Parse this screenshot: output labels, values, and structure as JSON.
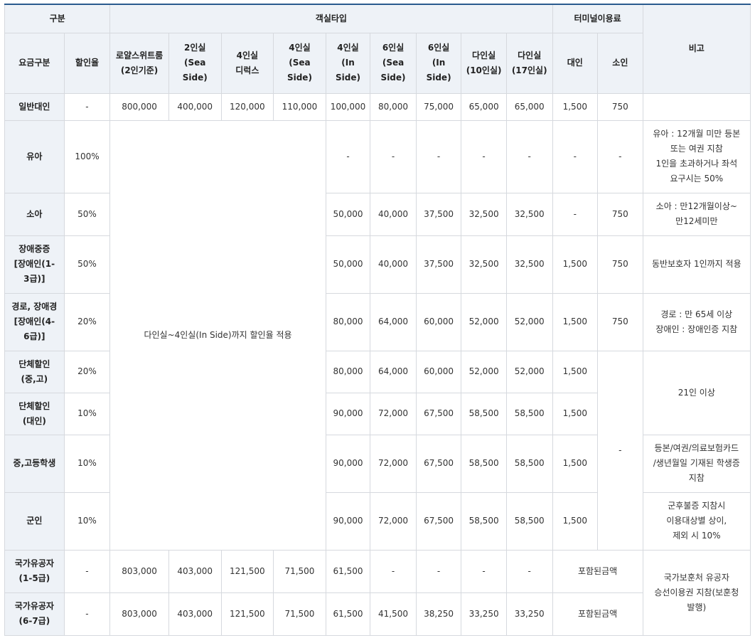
{
  "header": {
    "gubun": "구분",
    "room_type": "객실타입",
    "terminal_fee": "터미널이용료",
    "remarks": "비고",
    "fare_class": "요금구분",
    "discount_rate": "할인율",
    "rooms": [
      "로얄스위트룸\n(2인기준)",
      "2인실\n(Sea\nSide)",
      "4인실\n디럭스",
      "4인실\n(Sea\nSide)",
      "4인실\n(In Side)",
      "6인실\n(Sea\nSide)",
      "6인실\n(In\nSide)",
      "다인실\n(10인실)",
      "다인실\n(17인실)"
    ],
    "adult": "대인",
    "child": "소인"
  },
  "rows": {
    "general": {
      "label": "일반대인",
      "rate": "-",
      "prices": [
        "800,000",
        "400,000",
        "120,000",
        "110,000",
        "100,000",
        "80,000",
        "75,000",
        "65,000",
        "65,000"
      ],
      "adult_fee": "1,500",
      "child_fee": "750",
      "note": ""
    },
    "infant": {
      "label": "유아",
      "rate": "100%",
      "prices": [
        "-",
        "-",
        "-",
        "-",
        "-"
      ],
      "adult_fee": "-",
      "child_fee": "-",
      "note": "유아 : 12개월 미만 등본\n또는 여권 지참\n1인을 초과하거나 좌석\n요구시는 50%"
    },
    "child": {
      "label": "소아",
      "rate": "50%",
      "prices": [
        "50,000",
        "40,000",
        "37,500",
        "32,500",
        "32,500"
      ],
      "adult_fee": "-",
      "child_fee": "750",
      "note": "소아 : 만12개월이상~\n만12세미만"
    },
    "disabled_severe": {
      "label": "장애중증\n[장애인(1-\n3급)]",
      "rate": "50%",
      "prices": [
        "50,000",
        "40,000",
        "37,500",
        "32,500",
        "32,500"
      ],
      "adult_fee": "1,500",
      "child_fee": "750",
      "note": "동반보호자 1인까지 적용"
    },
    "senior": {
      "label": "경로, 장애경\n[장애인(4-\n6급)]",
      "rate": "20%",
      "prices": [
        "80,000",
        "64,000",
        "60,000",
        "52,000",
        "52,000"
      ],
      "adult_fee": "1,500",
      "child_fee": "750",
      "note": "경로 : 만 65세 이상\n장애인 : 장애인증 지참"
    },
    "group_student": {
      "label": "단체할인\n(중,고)",
      "rate": "20%",
      "prices": [
        "80,000",
        "64,000",
        "60,000",
        "52,000",
        "52,000"
      ],
      "adult_fee": "1,500"
    },
    "group_adult": {
      "label": "단체할인\n(대인)",
      "rate": "10%",
      "prices": [
        "90,000",
        "72,000",
        "67,500",
        "58,500",
        "58,500"
      ],
      "adult_fee": "1,500"
    },
    "student": {
      "label": "중,고등학생",
      "rate": "10%",
      "prices": [
        "90,000",
        "72,000",
        "67,500",
        "58,500",
        "58,500"
      ],
      "adult_fee": "1,500",
      "note": "등본/여권/의료보험카드\n/생년월일 기재된 학생증\n지참"
    },
    "soldier": {
      "label": "군인",
      "rate": "10%",
      "prices": [
        "90,000",
        "72,000",
        "67,500",
        "58,500",
        "58,500"
      ],
      "adult_fee": "1,500",
      "note": "군후불증 지참시\n이용대상별 상이,\n제외 시 10%"
    },
    "merit_1_5": {
      "label": "국가유공자\n(1-5급)",
      "rate": "-",
      "prices": [
        "803,000",
        "403,000",
        "121,500",
        "71,500",
        "61,500",
        "-",
        "-",
        "-",
        "-"
      ],
      "fee_included": "포함된금액"
    },
    "merit_6_7": {
      "label": "국가유공자\n(6-7급)",
      "rate": "-",
      "prices": [
        "803,000",
        "403,000",
        "121,500",
        "71,500",
        "61,500",
        "41,500",
        "38,250",
        "33,250",
        "33,250"
      ],
      "fee_included": "포함된금액"
    }
  },
  "merged": {
    "discount_note": "다인실~4인실(In Side)까지 할인율 적용",
    "group_note": "21인 이상",
    "child_fee_dash": "-",
    "merit_note": "국가보훈처 유공자\n승선이용권 지참(보훈청\n발행)"
  }
}
